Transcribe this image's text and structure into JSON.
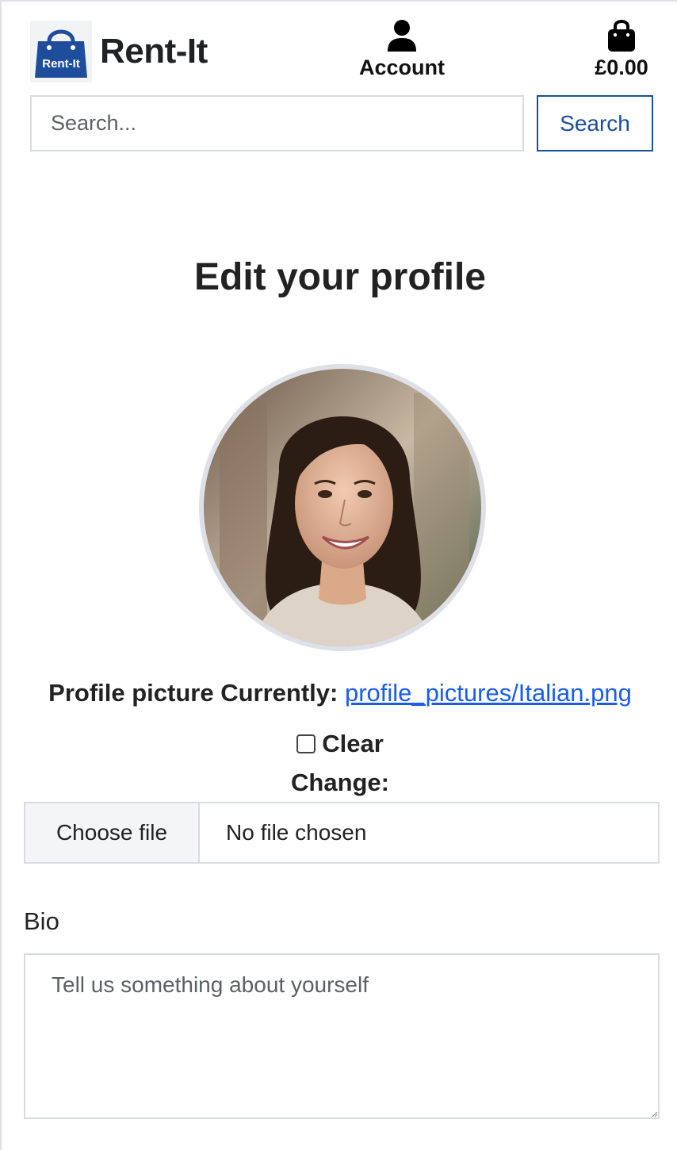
{
  "header": {
    "brand_name": "Rent-It",
    "logo_text": "Rent-It",
    "account_label": "Account",
    "cart_total": "£0.00"
  },
  "search": {
    "placeholder": "Search...",
    "value": "",
    "button_label": "Search"
  },
  "main": {
    "title": "Edit your profile",
    "profile_picture_label": "Profile picture",
    "currently_label": "Currently:",
    "current_file_link": "profile_pictures/Italian.png",
    "clear_label": "Clear",
    "clear_checked": false,
    "change_label": "Change:",
    "file_button_label": "Choose file",
    "file_status": "No file chosen",
    "bio_label": "Bio",
    "bio_placeholder": "Tell us something about yourself",
    "bio_value": ""
  },
  "colors": {
    "brand_blue": "#1e4d9c",
    "link_blue": "#1a5cf0",
    "border_gray": "#d9dcdf"
  },
  "icons": {
    "logo": "shopping-bag-logo",
    "account": "user-icon",
    "cart": "shopping-bag-icon"
  }
}
